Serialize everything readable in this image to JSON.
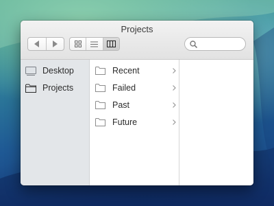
{
  "window": {
    "title": "Projects"
  },
  "toolbar": {
    "back_icon": "back-arrow-icon",
    "forward_icon": "forward-arrow-icon",
    "view_modes": [
      "icon-view-icon",
      "list-view-icon",
      "column-view-icon"
    ],
    "active_view": "column-view-icon",
    "search": {
      "placeholder": "",
      "value": ""
    }
  },
  "sidebar": {
    "items": [
      {
        "label": "Desktop",
        "icon": "desktop-icon"
      },
      {
        "label": "Projects",
        "icon": "folder-icon"
      }
    ]
  },
  "columns": [
    {
      "items": [
        {
          "label": "Recent",
          "icon": "folder-icon",
          "has_children": true
        },
        {
          "label": "Failed",
          "icon": "folder-icon",
          "has_children": true
        },
        {
          "label": "Past",
          "icon": "folder-icon",
          "has_children": true
        },
        {
          "label": "Future",
          "icon": "folder-icon",
          "has_children": true
        }
      ]
    },
    {
      "items": []
    }
  ],
  "colors": {
    "sidebar_bg": "#e3e6e9",
    "toolbar_bg": "#e8e8e8",
    "icon_stroke": "#6b6b6b"
  }
}
